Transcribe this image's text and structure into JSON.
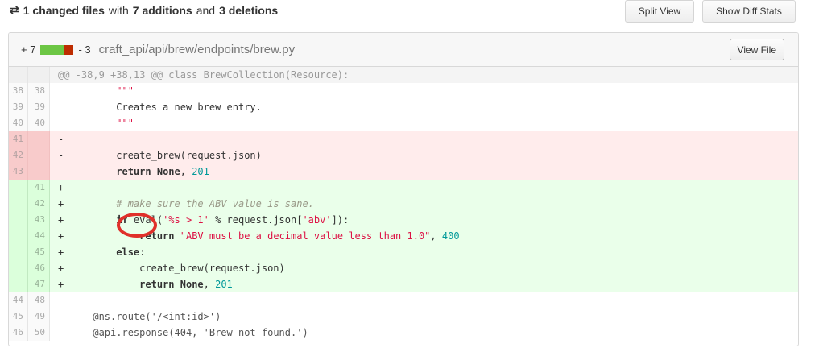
{
  "summary": {
    "icon": "sync-icon",
    "changed_files": "1 changed files",
    "with": "with",
    "additions": "7 additions",
    "and": "and",
    "deletions": "3 deletions"
  },
  "buttons": {
    "split_view": "Split View",
    "diff_stats": "Show Diff Stats"
  },
  "file": {
    "additions": "+ 7",
    "deletions": "- 3",
    "path": "craft_api/api/brew/endpoints/brew.py",
    "view_file": "View File"
  },
  "hunk_header": "@@ -38,9 +38,13 @@ class BrewCollection(Resource):",
  "lines": [
    {
      "old": "38",
      "new": "38",
      "marker": "",
      "code": "        \"\"\""
    },
    {
      "old": "39",
      "new": "39",
      "marker": "",
      "code": "        Creates a new brew entry."
    },
    {
      "old": "40",
      "new": "40",
      "marker": "",
      "code": "        \"\"\""
    },
    {
      "old": "41",
      "new": "",
      "marker": "-",
      "code": ""
    },
    {
      "old": "42",
      "new": "",
      "marker": "-",
      "code": "        create_brew(request.json)"
    },
    {
      "old": "43",
      "new": "",
      "marker": "-",
      "code": "        return None, 201"
    },
    {
      "old": "",
      "new": "41",
      "marker": "+",
      "code": ""
    },
    {
      "old": "",
      "new": "42",
      "marker": "+",
      "code": "        # make sure the ABV value is sane."
    },
    {
      "old": "",
      "new": "43",
      "marker": "+",
      "code": "        if eval('%s > 1' % request.json['abv']):"
    },
    {
      "old": "",
      "new": "44",
      "marker": "+",
      "code": "            return \"ABV must be a decimal value less than 1.0\", 400"
    },
    {
      "old": "",
      "new": "45",
      "marker": "+",
      "code": "        else:"
    },
    {
      "old": "",
      "new": "46",
      "marker": "+",
      "code": "            create_brew(request.json)"
    },
    {
      "old": "",
      "new": "47",
      "marker": "+",
      "code": "            return None, 201"
    },
    {
      "old": "44",
      "new": "48",
      "marker": "",
      "code": ""
    },
    {
      "old": "45",
      "new": "49",
      "marker": "",
      "code": "    @ns.route('/<int:id>')"
    },
    {
      "old": "46",
      "new": "50",
      "marker": "",
      "code": "    @api.response(404, 'Brew not found.')"
    }
  ],
  "annotation": {
    "color": "#e0302a"
  },
  "colors": {
    "addition": "#6cc644",
    "deletion": "#bd2c00"
  }
}
